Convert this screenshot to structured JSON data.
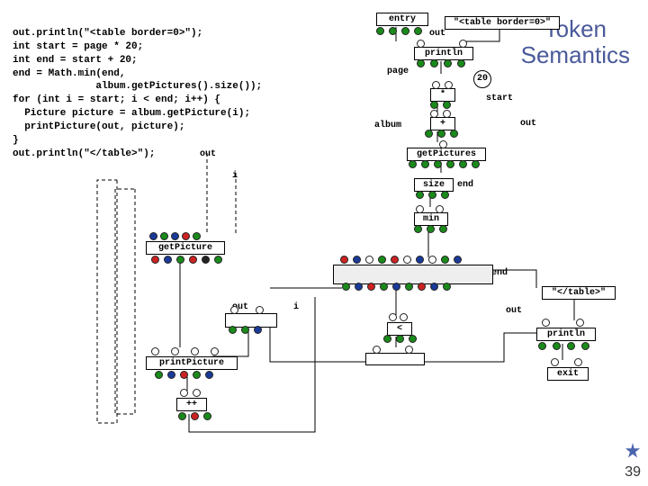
{
  "title_line1": "Token",
  "title_line2": "Semantics",
  "code": "out.println(\"<table border=0>\");\nint start = page * 20;\nint end = start + 20;\nend = Math.min(end,\n              album.getPictures().size());\nfor (int i = start; i < end; i++) {\n  Picture picture = album.getPicture(i);\n  printPicture(out, picture);\n}\nout.println(\"</table>\");",
  "labels": {
    "entry": "entry",
    "out_top": "out",
    "tbl_lit": "\"<table border=0>\"",
    "println1": "println",
    "page": "page",
    "twenty": "20",
    "star": "*",
    "start": "start",
    "plus": "+",
    "out_mid": "out",
    "album": "album",
    "getPictures": "getPictures",
    "size": "size",
    "end_lbl": "end",
    "min": "min",
    "getPicture": "getPicture",
    "end2": "end",
    "out3": "out",
    "i_lbl": "i",
    "i2": "i",
    "lt": "<",
    "printPicture": "printPicture",
    "pp": "++",
    "println2": "println",
    "out4": "out",
    "closetbl": "\"</table>\"",
    "exit": "exit"
  },
  "pagenum": "39"
}
